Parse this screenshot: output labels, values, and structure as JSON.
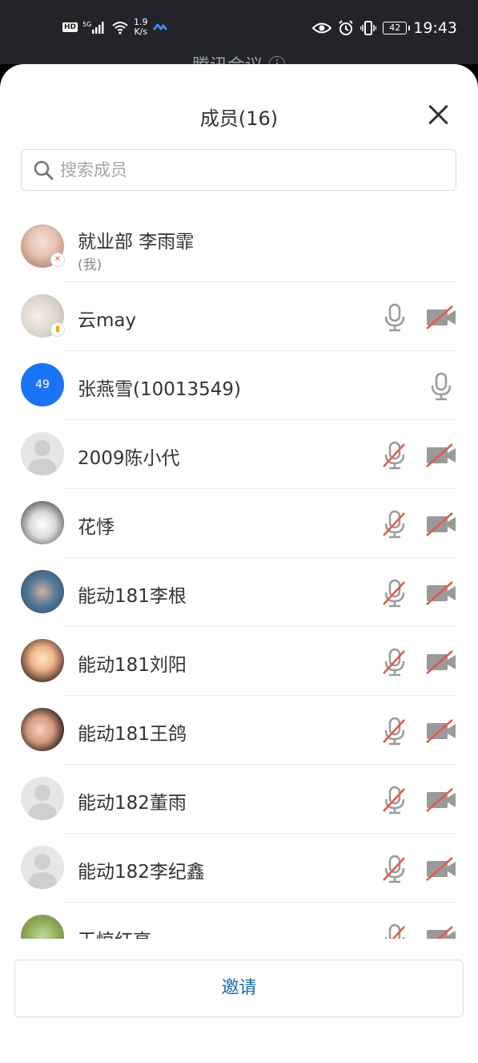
{
  "status_bar": {
    "hd": "HD",
    "network": "5G",
    "speed_value": "1.9",
    "speed_unit": "K/s",
    "battery": "42",
    "time": "19:43"
  },
  "behind": {
    "title": "腾讯会议 ⓘ"
  },
  "sheet": {
    "title": "成员(16)"
  },
  "search": {
    "placeholder": "搜索成员"
  },
  "members": [
    {
      "name": "就业部 李雨霏",
      "sub": "(我)",
      "avatar": "photo",
      "mic": "none",
      "cam": "none"
    },
    {
      "name": "云may",
      "sub": "",
      "avatar": "photo",
      "mic": "on",
      "cam": "off"
    },
    {
      "name": "张燕雪(10013549)",
      "sub": "",
      "avatar": "49",
      "mic": "on",
      "cam": "none"
    },
    {
      "name": "2009陈小代",
      "sub": "",
      "avatar": "default",
      "mic": "off",
      "cam": "off"
    },
    {
      "name": "花悸",
      "sub": "",
      "avatar": "photo",
      "mic": "off",
      "cam": "off"
    },
    {
      "name": "能动181李根",
      "sub": "",
      "avatar": "photo",
      "mic": "off",
      "cam": "off"
    },
    {
      "name": "能动181刘阳",
      "sub": "",
      "avatar": "photo",
      "mic": "off",
      "cam": "off"
    },
    {
      "name": "能动181王鸽",
      "sub": "",
      "avatar": "photo",
      "mic": "off",
      "cam": "off"
    },
    {
      "name": "能动182董雨",
      "sub": "",
      "avatar": "default",
      "mic": "off",
      "cam": "off"
    },
    {
      "name": "能动182李纪鑫",
      "sub": "",
      "avatar": "default",
      "mic": "off",
      "cam": "off"
    },
    {
      "name": "王惊红亮",
      "sub": "",
      "avatar": "photo",
      "mic": "off",
      "cam": "off"
    }
  ],
  "invite": {
    "label": "邀请"
  },
  "colors": {
    "accent": "#1b6ea8",
    "muted_red": "#e05a4f",
    "icon_gray": "#9a9a9a",
    "avatar_blue": "#1a73f5"
  }
}
